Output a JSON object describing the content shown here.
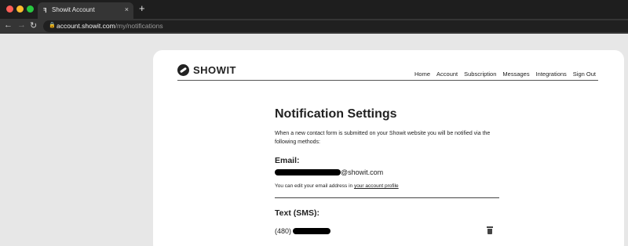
{
  "browser": {
    "tab_title": "Showit Account",
    "tab_favicon": "showit-favicon",
    "close_tab": "×",
    "new_tab": "+",
    "url_domain": "account.showit.com",
    "url_path": "/my/notifications"
  },
  "header": {
    "logo_text": "SHOWIT",
    "nav": [
      "Home",
      "Account",
      "Subscription",
      "Messages",
      "Integrations",
      "Sign Out"
    ]
  },
  "main": {
    "title": "Notification Settings",
    "intro": "When a new contact form is submitted on your Showit website you will be notified via the following methods:",
    "email_heading": "Email:",
    "email_suffix": "@showit.com",
    "help_prefix": "You can edit your email address in ",
    "help_link": "your account profile",
    "sms_heading": "Text (SMS):",
    "phone_prefix": "(480)"
  },
  "icons": [
    "back-arrow-icon",
    "forward-arrow-icon",
    "reload-icon",
    "lock-icon",
    "trash-icon"
  ],
  "colors": {
    "page_bg": "#e7e7e7",
    "card_bg": "#ffffff",
    "chrome_bg": "#1e1e1e"
  }
}
